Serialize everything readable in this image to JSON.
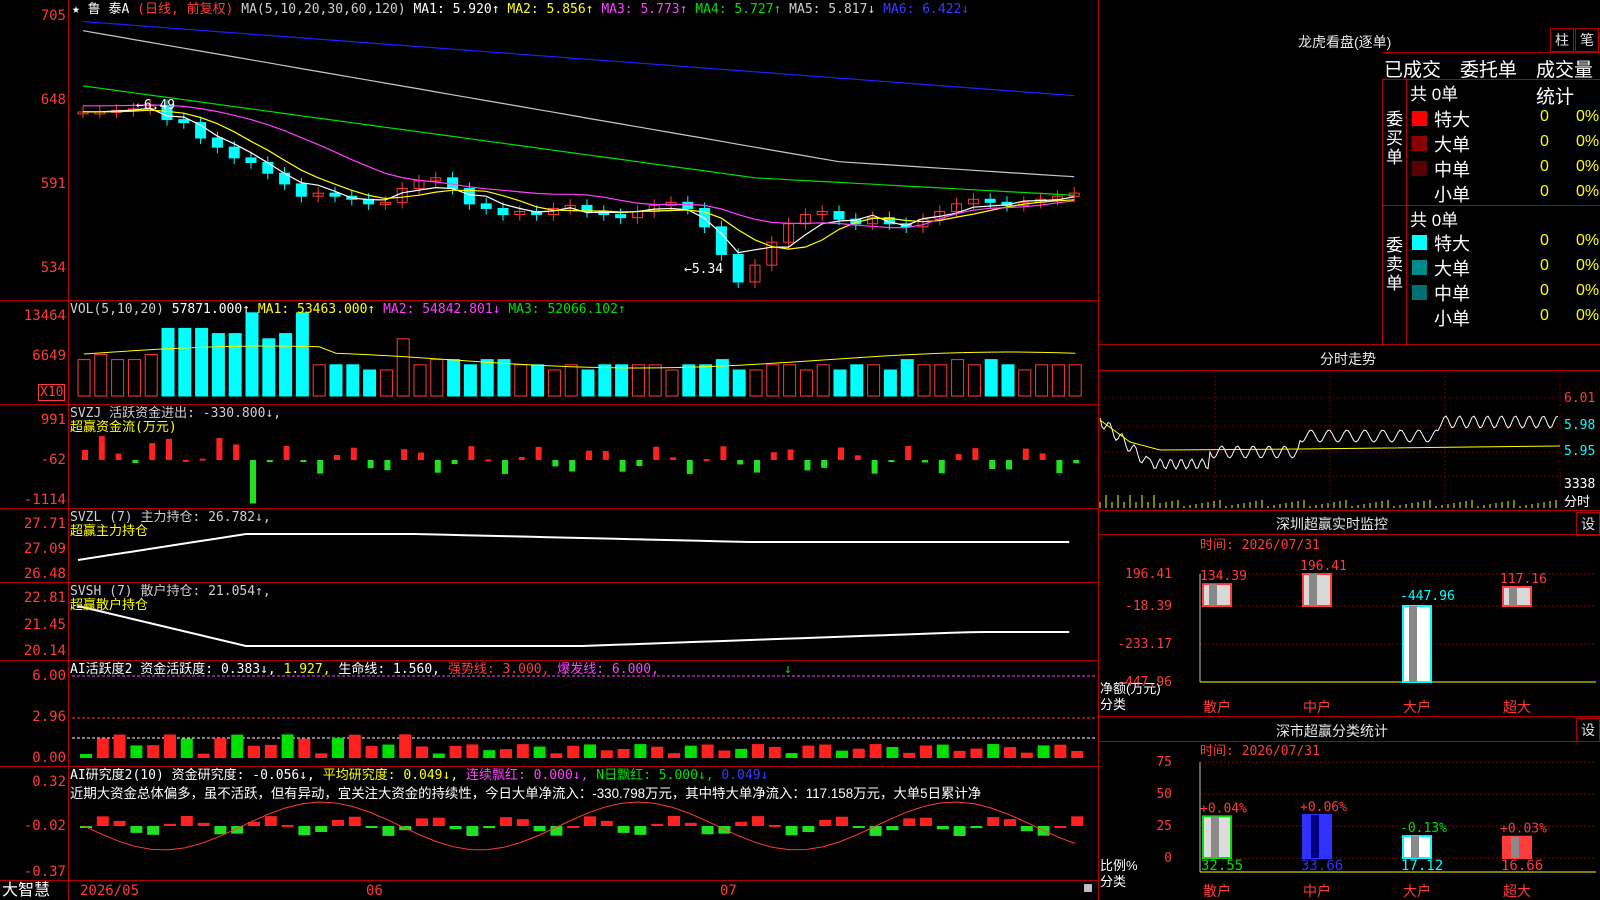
{
  "main_chart": {
    "title_star": "★",
    "stock_name": "鲁  泰A",
    "period": "(日线, 前复权)",
    "ma_label": "MA(5,10,20,30,60,120)",
    "ma1": "MA1: 5.920↑",
    "ma2": "MA2: 5.856↑",
    "ma3": "MA3: 5.773↑",
    "ma4": "MA4: 5.727↑",
    "ma5": "MA5: 5.817↓",
    "ma6": "MA6: 6.422↓",
    "axis": [
      "705",
      "648",
      "591",
      "534"
    ],
    "high_mark": "←6.49",
    "low_mark": "←5.34"
  },
  "vol_chart": {
    "label": "VOL(5,10,20)",
    "value": "57871.000↑",
    "ma1": "MA1: 53463.000↑",
    "ma2": "MA2: 54842.801↓",
    "ma3": "MA3: 52066.102↑",
    "axis": [
      "13464",
      "6649"
    ],
    "unit": "X10"
  },
  "svzj": {
    "label": "SVZJ  活跃资金进出: -330.800↓,",
    "sub": "超赢资金流(万元)",
    "axis": [
      "991",
      "-62",
      "-1114"
    ]
  },
  "svzl": {
    "label": "SVZL (7) 主力持仓: 26.782↓,",
    "sub": "超赢主力持仓",
    "axis": [
      "27.71",
      "27.09",
      "26.48"
    ]
  },
  "svsh": {
    "label": "SVSH (7) 散户持仓: 21.054↑,",
    "sub": "超赢散户持仓",
    "axis": [
      "22.81",
      "21.45",
      "20.14"
    ]
  },
  "ai_active": {
    "label": "AI活跃度2 资金活跃度: 0.383↓,",
    "v2": "1.927,",
    "life": "生命线: 1.560,",
    "strong": "强势线: 3.000,",
    "burst": "爆发线: 6.000,",
    "arrow": "↓",
    "axis": [
      "6.00",
      "2.96",
      "0.00"
    ]
  },
  "ai_research": {
    "label": "AI研究度2(10) 资金研究度: -0.056↓,",
    "avg": "平均研究度: 0.049↓,",
    "cont": "连续飘红: 0.000↓,",
    "nday": "N日飘红: 5.000↓,",
    "last": "0.049↓",
    "commentary": "近期大资金总体偏多，虽不活跃，但有异动，宜关注大资金的持续性，今日大单净流入：-330.798万元，其中特大单净流入：117.158万元，大单5日累计净",
    "axis": [
      "0.32",
      "-0.02",
      "-0.37"
    ]
  },
  "bottom_bar": {
    "brand": "大智慧",
    "dates": [
      "2026/05",
      "06",
      "07"
    ]
  },
  "dragon_panel": {
    "title": "龙虎看盘(逐单)",
    "btn_bar": "柱",
    "btn_pen": "笔",
    "tabs": [
      "已成交",
      "委托单",
      "成交量统计"
    ],
    "buy_side": "委买单",
    "sell_side": "委卖单",
    "buy_total": "共 0单",
    "sell_total": "共 0单",
    "rows": [
      {
        "label": "特大",
        "count": "0",
        "pct": "0%"
      },
      {
        "label": "大单",
        "count": "0",
        "pct": "0%"
      },
      {
        "label": "中单",
        "count": "0",
        "pct": "0%"
      },
      {
        "label": "小单",
        "count": "0",
        "pct": "0%"
      }
    ],
    "buy_colors": [
      "#ff0000",
      "#8b0000",
      "#5a0000",
      "#000000"
    ],
    "sell_colors": [
      "#00ffff",
      "#008b8b",
      "#007070",
      "#000000"
    ]
  },
  "intraday": {
    "title": "分时走势",
    "axis": [
      "6.01",
      "5.98",
      "5.95"
    ],
    "vol_label": "3338",
    "unit": "分时"
  },
  "monitor": {
    "title": "深圳超赢实时监控",
    "btn": "设",
    "time": "时间: 2026/07/31",
    "axis": [
      "196.41",
      "-18.39",
      "-233.17",
      "-447.96"
    ],
    "ylabel": "净额(万元)",
    "xlabel": "分类",
    "categories": [
      "散户",
      "中户",
      "大户",
      "超大"
    ],
    "values": [
      134.39,
      196.41,
      -447.96,
      117.16
    ],
    "value_labels": [
      "134.39",
      "196.41",
      "-447.96",
      "117.16"
    ]
  },
  "stats": {
    "title": "深市超赢分类统计",
    "btn": "设",
    "time": "时间: 2026/07/31",
    "axis": [
      "75",
      "50",
      "25",
      "0"
    ],
    "ylabel": "比例%",
    "xlabel": "分类",
    "categories": [
      "散户",
      "中户",
      "大户",
      "超大"
    ],
    "values": [
      32.55,
      33.66,
      17.12,
      16.66
    ],
    "value_labels": [
      "32.55",
      "33.66",
      "17.12",
      "16.66"
    ],
    "change_labels": [
      "+0.04%",
      "+0.06%",
      "-0.13%",
      "+0.03%"
    ]
  },
  "chart_data": {
    "type": "bar",
    "title": "深圳超赢实时监控",
    "categories": [
      "散户",
      "中户",
      "大户",
      "超大"
    ],
    "series": [
      {
        "name": "净额(万元)",
        "values": [
          134.39,
          196.41,
          -447.96,
          117.16
        ]
      },
      {
        "name": "比例%",
        "values": [
          32.55,
          33.66,
          17.12,
          16.66
        ]
      }
    ]
  }
}
